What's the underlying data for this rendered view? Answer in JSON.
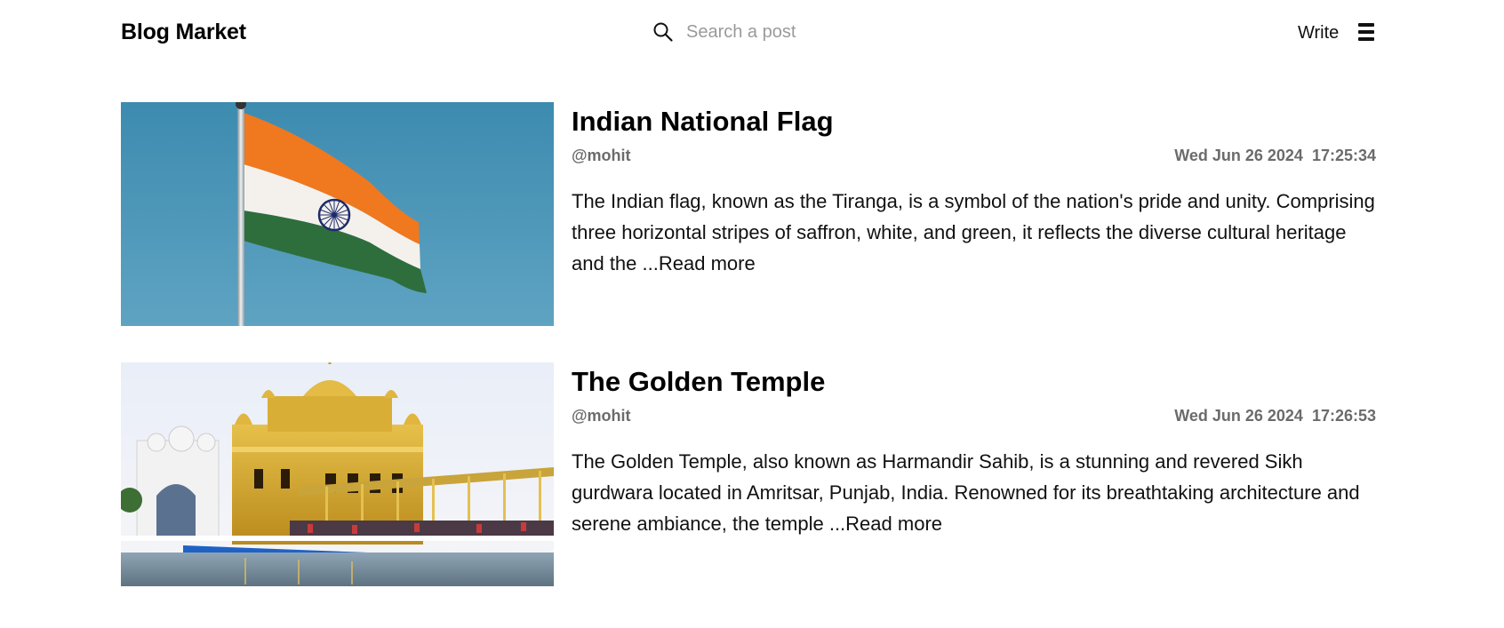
{
  "header": {
    "brand": "Blog Market",
    "search": {
      "placeholder": "Search a post",
      "value": ""
    },
    "write_label": "Write"
  },
  "posts": [
    {
      "title": "Indian National Flag",
      "author": "@mohit",
      "date": "Wed Jun 26 2024  17:25:34",
      "excerpt": "The Indian flag, known as the Tiranga, is a symbol of the nation's pride and unity. Comprising three horizontal stripes of saffron, white, and green, it reflects the diverse cultural heritage and the ...",
      "read_more": "Read more"
    },
    {
      "title": "The Golden Temple",
      "author": "@mohit",
      "date": "Wed Jun 26 2024  17:26:53",
      "excerpt": "The Golden Temple, also known as Harmandir Sahib, is a stunning and revered Sikh gurdwara located in Amritsar, Punjab, India. Renowned for its breathtaking architecture and serene ambiance, the temple ...",
      "read_more": "Read more"
    }
  ],
  "colors": {
    "text": "#111111",
    "muted": "#6b6b6b",
    "placeholder": "#9a9a9a",
    "sky": "#4a93b4",
    "saffron": "#f0781e",
    "green": "#2e6e3c",
    "gold": "#d4a22a"
  },
  "icons": {
    "search": "search-icon",
    "menu": "hamburger-menu-icon",
    "chakra": "ashoka-chakra-icon"
  }
}
